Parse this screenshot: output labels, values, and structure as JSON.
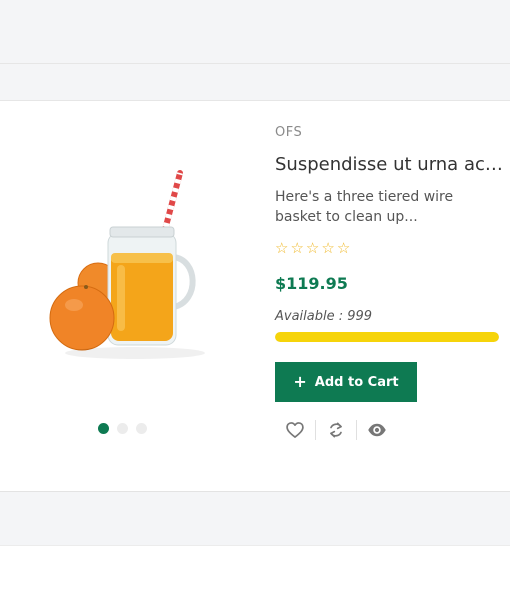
{
  "product": {
    "brand": "OFS",
    "title": "Suspendisse ut urna ac ...",
    "description": "Here's a three tiered wire basket to clean up...",
    "rating": 0,
    "rating_max": 5,
    "price": "$119.95",
    "availability": "Available : 999",
    "stock_fill_fraction": 1.0,
    "add_to_cart_label": "Add to Cart",
    "image": {
      "subject": "orange-juice-jar-with-oranges"
    }
  },
  "carousel": {
    "slides": 3,
    "active_index": 0
  },
  "icons": {
    "wishlist": "heart-icon",
    "compare": "refresh-icon",
    "quickview": "eye-icon",
    "add": "plus-icon",
    "rating": "star-outline-icon"
  },
  "colors": {
    "accent": "#0e7a52",
    "star": "#f0b92a",
    "stock_bar": "#f6d40a",
    "background": "#f4f5f7"
  }
}
